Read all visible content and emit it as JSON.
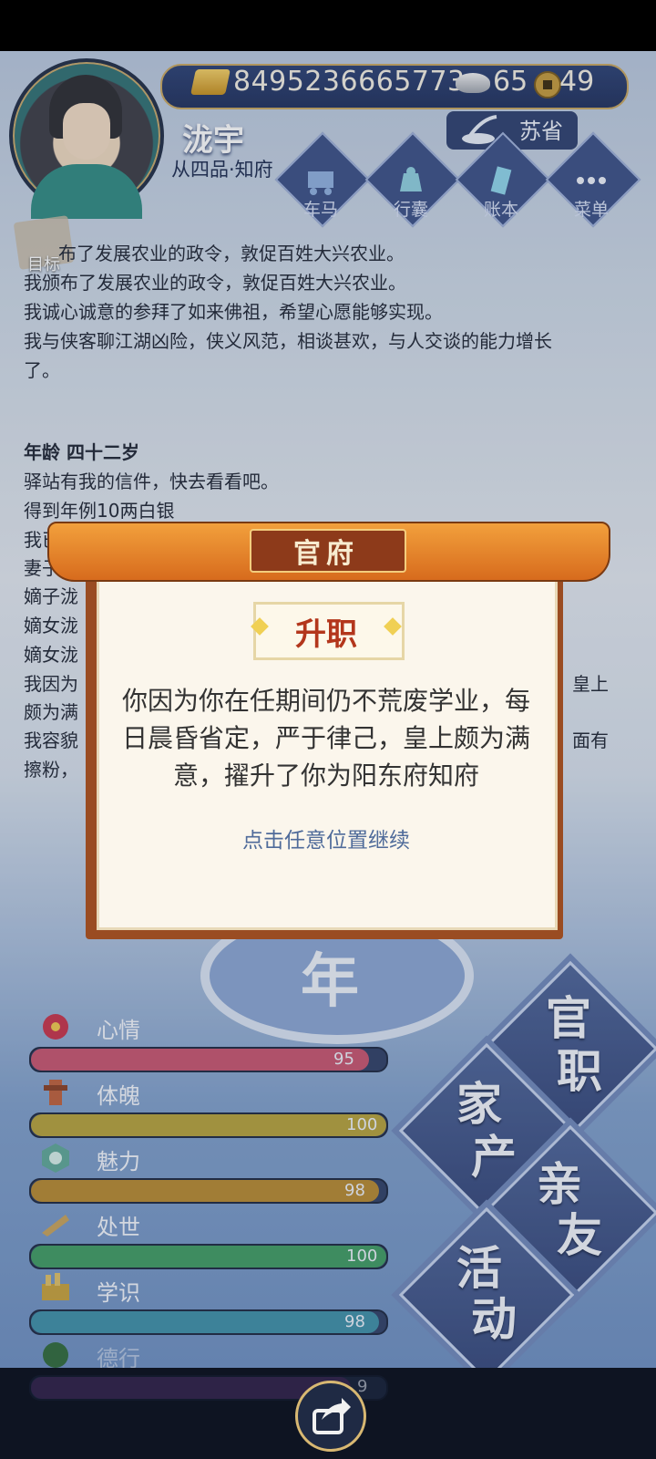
{
  "header": {
    "gold": "8495236665773",
    "silver": "65",
    "coins": "49",
    "name": "泷宇",
    "rank": "从四品·知府",
    "region": "苏省",
    "nav": [
      "车马",
      "行囊",
      "账本",
      "菜单"
    ]
  },
  "target_label": "目标",
  "log": {
    "lines_top": [
      "布了发展农业的政令，敦促百姓大兴农业。",
      "我颁布了发展农业的政令，敦促百姓大兴农业。",
      "我诚心诚意的参拜了如来佛祖，希望心愿能够实现。",
      "我与侠客聊江湖凶险，侠义风范，相谈甚欢，与人交谈的能力增长",
      "了。"
    ],
    "age": "年龄 四十二岁",
    "lines_after_age": [
      "驿站有我的信件，快去看看吧。",
      "得到年例10两白银",
      "我已",
      "妻子泷",
      "嫡子泷",
      "嫡女泷",
      "嫡女泷",
      "我因为",
      "颇为满",
      "我容貌",
      "擦粉，"
    ],
    "right_fragments": [
      "皇上",
      "面有"
    ]
  },
  "year_char": "年",
  "stats": [
    {
      "label": "心情",
      "value": 95,
      "max": 100,
      "color": "#c9546e"
    },
    {
      "label": "体魄",
      "value": 100,
      "max": 100,
      "color": "#b6a23a"
    },
    {
      "label": "魅力",
      "value": 98,
      "max": 100,
      "color": "#b8892f"
    },
    {
      "label": "处世",
      "value": 100,
      "max": 100,
      "color": "#3f9c62"
    },
    {
      "label": "学识",
      "value": 98,
      "max": 100,
      "color": "#3d8fa8"
    },
    {
      "label": "德行",
      "value": null,
      "max": 100,
      "color": "#6a3f8d"
    }
  ],
  "stat_partial_value": "9",
  "actions": {
    "official": [
      "官",
      "职"
    ],
    "property": [
      "家",
      "产"
    ],
    "relatives": [
      "亲",
      "友"
    ],
    "activity": [
      "活",
      "动"
    ]
  },
  "popup": {
    "title": "官府",
    "subtitle": "升职",
    "message": "你因为你在任期间仍不荒废学业，每日晨昏省定，严于律己，皇上颇为满意，擢升了你为阳东府知府",
    "continue": "点击任意位置继续"
  }
}
